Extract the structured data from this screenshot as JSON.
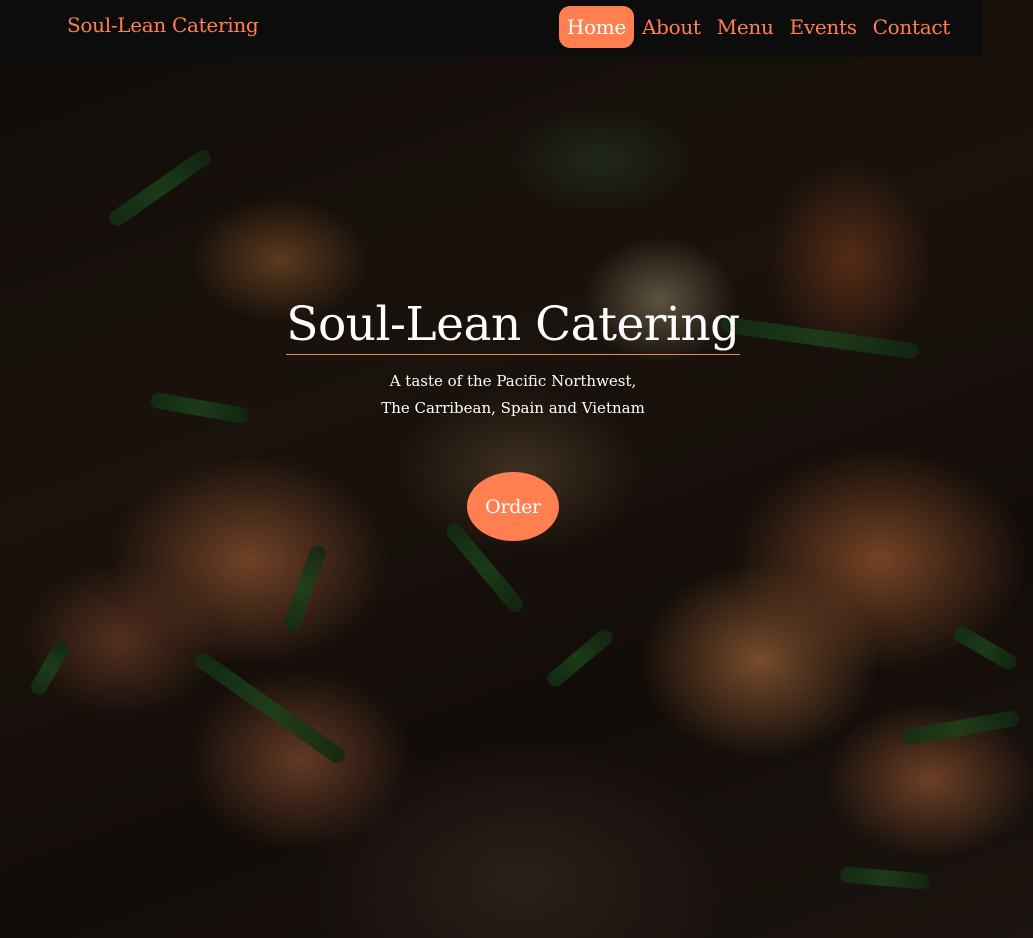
{
  "brand": "Soul-Lean Catering",
  "nav": {
    "items": [
      {
        "label": "Home"
      },
      {
        "label": "About"
      },
      {
        "label": "Menu"
      },
      {
        "label": "Events"
      },
      {
        "label": "Contact"
      }
    ],
    "active": "Home"
  },
  "hero": {
    "title": "Soul-Lean Catering",
    "tagline_line1": "A taste of the Pacific Northwest,",
    "tagline_line2": "The Carribean, Spain and Vietnam",
    "order_label": "Order"
  },
  "colors": {
    "accent": "#ff7f50",
    "navbar": "#0c0c0c",
    "text_light": "#ffffff"
  }
}
